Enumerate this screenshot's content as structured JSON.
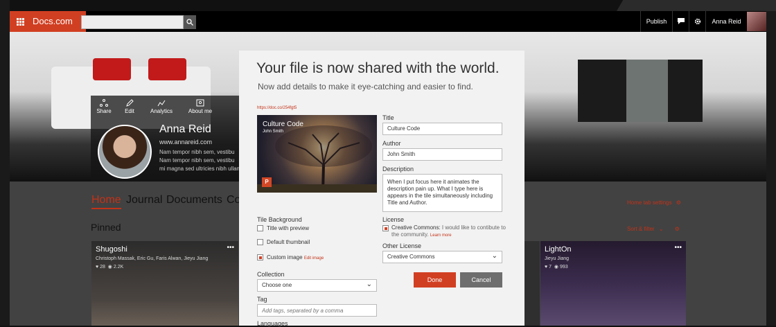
{
  "topbar": {
    "brand": "Docs.com",
    "search_placeholder": "",
    "publish": "Publish",
    "user": "Anna Reid"
  },
  "profile": {
    "actions": [
      "Share",
      "Edit",
      "Analytics",
      "About me"
    ],
    "name": "Anna Reid",
    "url": "www.annareid.com",
    "bio": "Nam tempor nibh sem, vestibu\nNam tempor nibh sem, vestibu\nmi magna sed ultricies nibh ullam"
  },
  "nav": {
    "tabs": [
      "Home",
      "Journal",
      "Documents",
      "Co"
    ],
    "home_settings": "Home tab settings",
    "pinned": "Pinned",
    "sort": "Sort & filter"
  },
  "tiles": [
    {
      "title": "Shugoshi",
      "authors": "Christoph Massak, Eric Gu, Faris Alwan, Jieyu Jiang",
      "likes": "28",
      "views": "2.2K"
    },
    {
      "title": "LightOn",
      "authors": "Jieyu Jiang",
      "likes": "7",
      "views": "993"
    }
  ],
  "modal": {
    "title": "Your file is now shared with the world.",
    "subtitle": "Now add details to make it eye-catching and easier to find.",
    "url": "https://doc.co/254fgt5",
    "preview": {
      "title": "Culture Code",
      "author": "John Smith"
    },
    "title_label": "Title",
    "title_value": "Culture Code",
    "author_label": "Author",
    "author_value": "John Smith",
    "description_label": "Description",
    "description_value": "When I put focus here it animates the description pain up. What I type here is appears in the tile simultaneously including Title and Author.",
    "tile_bg_label": "Tile Background",
    "tile_bg_options": [
      "Title with preview",
      "Default thumbnail",
      "Custom image"
    ],
    "edit_image": "Edit image",
    "license_label": "License",
    "license_cc_strong": "Creative Commons:",
    "license_cc_text": " I would like to contibute to the community.",
    "learn_more": "Learn more",
    "other_license_label": "Other License",
    "other_license_value": "Creative Commons",
    "collection_label": "Collection",
    "collection_value": "Choose one",
    "tag_label": "Tag",
    "tag_placeholder": "Add tags, separated by a comma",
    "languages_label": "Languages",
    "done": "Done",
    "cancel": "Cancel"
  },
  "colors": {
    "accent": "#d13f22",
    "topbar": "#000000",
    "modal_bg": "#f2f2f2"
  }
}
